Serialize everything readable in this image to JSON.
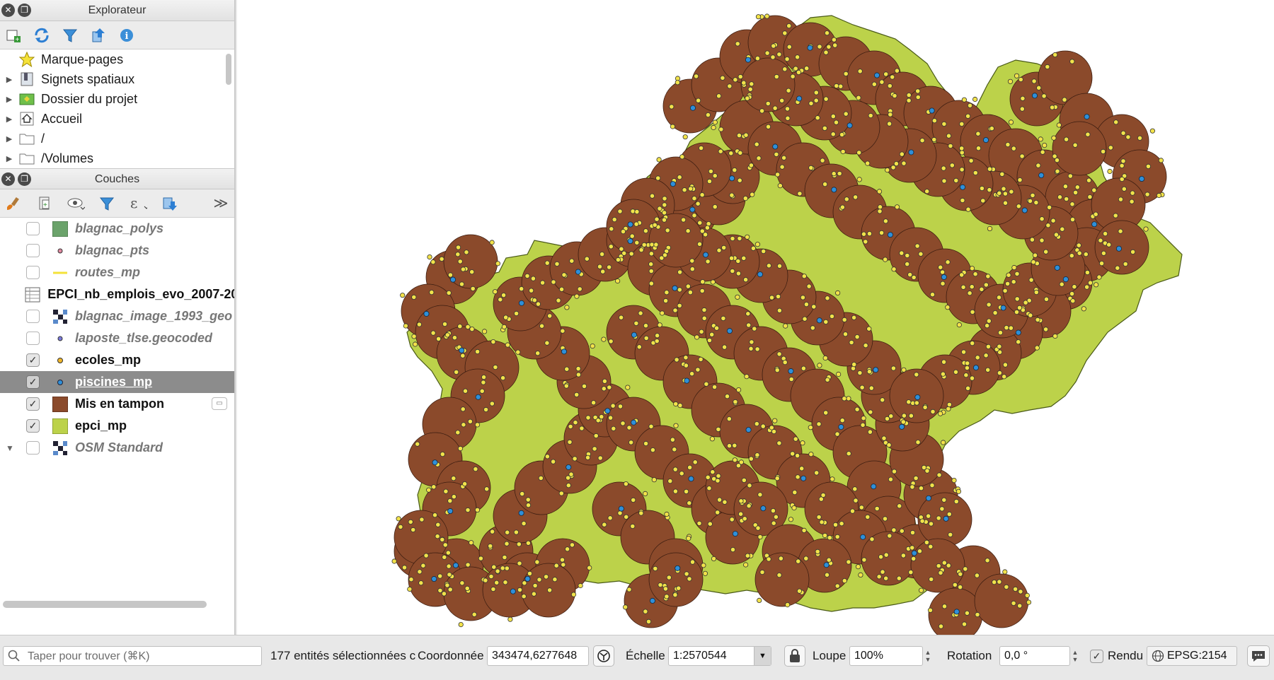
{
  "browser": {
    "title": "Explorateur",
    "items": [
      {
        "label": "Marque-pages",
        "icon": "star-icon"
      },
      {
        "label": "Signets spatiaux",
        "icon": "bookmark-icon"
      },
      {
        "label": "Dossier du projet",
        "icon": "project-folder-icon"
      },
      {
        "label": "Accueil",
        "icon": "home-icon"
      },
      {
        "label": "/",
        "icon": "folder-icon"
      },
      {
        "label": "/Volumes",
        "icon": "folder-icon"
      }
    ]
  },
  "layers": {
    "title": "Couches",
    "items": [
      {
        "name": "blagnac_polys",
        "checked": false,
        "symbol": "green-square"
      },
      {
        "name": "blagnac_pts",
        "checked": false,
        "symbol": "pink-dot"
      },
      {
        "name": "routes_mp",
        "checked": false,
        "symbol": "yellow-line"
      },
      {
        "name": "EPCI_nb_emplois_evo_2007-20",
        "checked": null,
        "symbol": "table"
      },
      {
        "name": "blagnac_image_1993_geo",
        "checked": false,
        "symbol": "raster"
      },
      {
        "name": "laposte_tlse.geocoded",
        "checked": false,
        "symbol": "blue-dot"
      },
      {
        "name": "ecoles_mp",
        "checked": true,
        "symbol": "orange-dot"
      },
      {
        "name": "piscines_mp",
        "checked": true,
        "symbol": "blue-dot",
        "selected": true
      },
      {
        "name": "Mis en tampon",
        "checked": true,
        "symbol": "brown-square"
      },
      {
        "name": "epci_mp",
        "checked": true,
        "symbol": "lime-square"
      },
      {
        "name": "OSM Standard",
        "checked": false,
        "symbol": "raster"
      }
    ]
  },
  "statusbar": {
    "search_placeholder": "Taper pour trouver (⌘K)",
    "selection_text": "177 entités sélectionnées c",
    "coord_label": "Coordonnée",
    "coord_value": "343474,6277648",
    "scale_label": "Échelle",
    "scale_value": "1:2570544",
    "magnifier_label": "Loupe",
    "magnifier_value": "100%",
    "rotation_label": "Rotation",
    "rotation_value": "0,0 °",
    "render_label": "Rendu",
    "crs": "EPSG:2154"
  },
  "colors": {
    "buffer": "#8b4a2b",
    "epci": "#bcd24a",
    "school": "#f2e24a",
    "pool": "#2f8fd8",
    "selected_row": "#8c8c8c"
  }
}
